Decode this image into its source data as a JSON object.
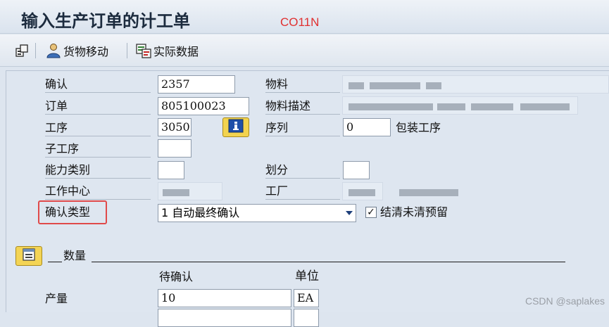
{
  "title": "输入生产订单的计工单",
  "tcode": "CO11N",
  "toolbar": {
    "goods_movement": "货物移动",
    "actual_data": "实际数据"
  },
  "form": {
    "confirmation_label": "确认",
    "confirmation_value": "2357",
    "order_label": "订单",
    "order_value": "805100023",
    "operation_label": "工序",
    "operation_value": "3050",
    "sub_operation_label": "子工序",
    "capacity_category_label": "能力类别",
    "work_center_label": "工作中心",
    "confirmation_type_label": "确认类型",
    "confirmation_type_value": "1 自动最终确认",
    "material_label": "物料",
    "material_desc_label": "物料描述",
    "sequence_label": "序列",
    "sequence_value": "0",
    "packaging_operation": "包装工序",
    "split_label": "划分",
    "plant_label": "工厂",
    "clear_reservation_label": "结清未清预留",
    "clear_reservation_checked": true
  },
  "quantity_section": {
    "title": "数量",
    "to_confirm_header": "待确认",
    "unit_header": "单位",
    "yield_label": "产量",
    "yield_value": "10",
    "unit_value": "EA"
  },
  "colors": {
    "tcode": "#e03030",
    "highlight_box": "#e04a4a",
    "info_button": "#f2d34f"
  },
  "watermark": "CSDN @saplakes"
}
